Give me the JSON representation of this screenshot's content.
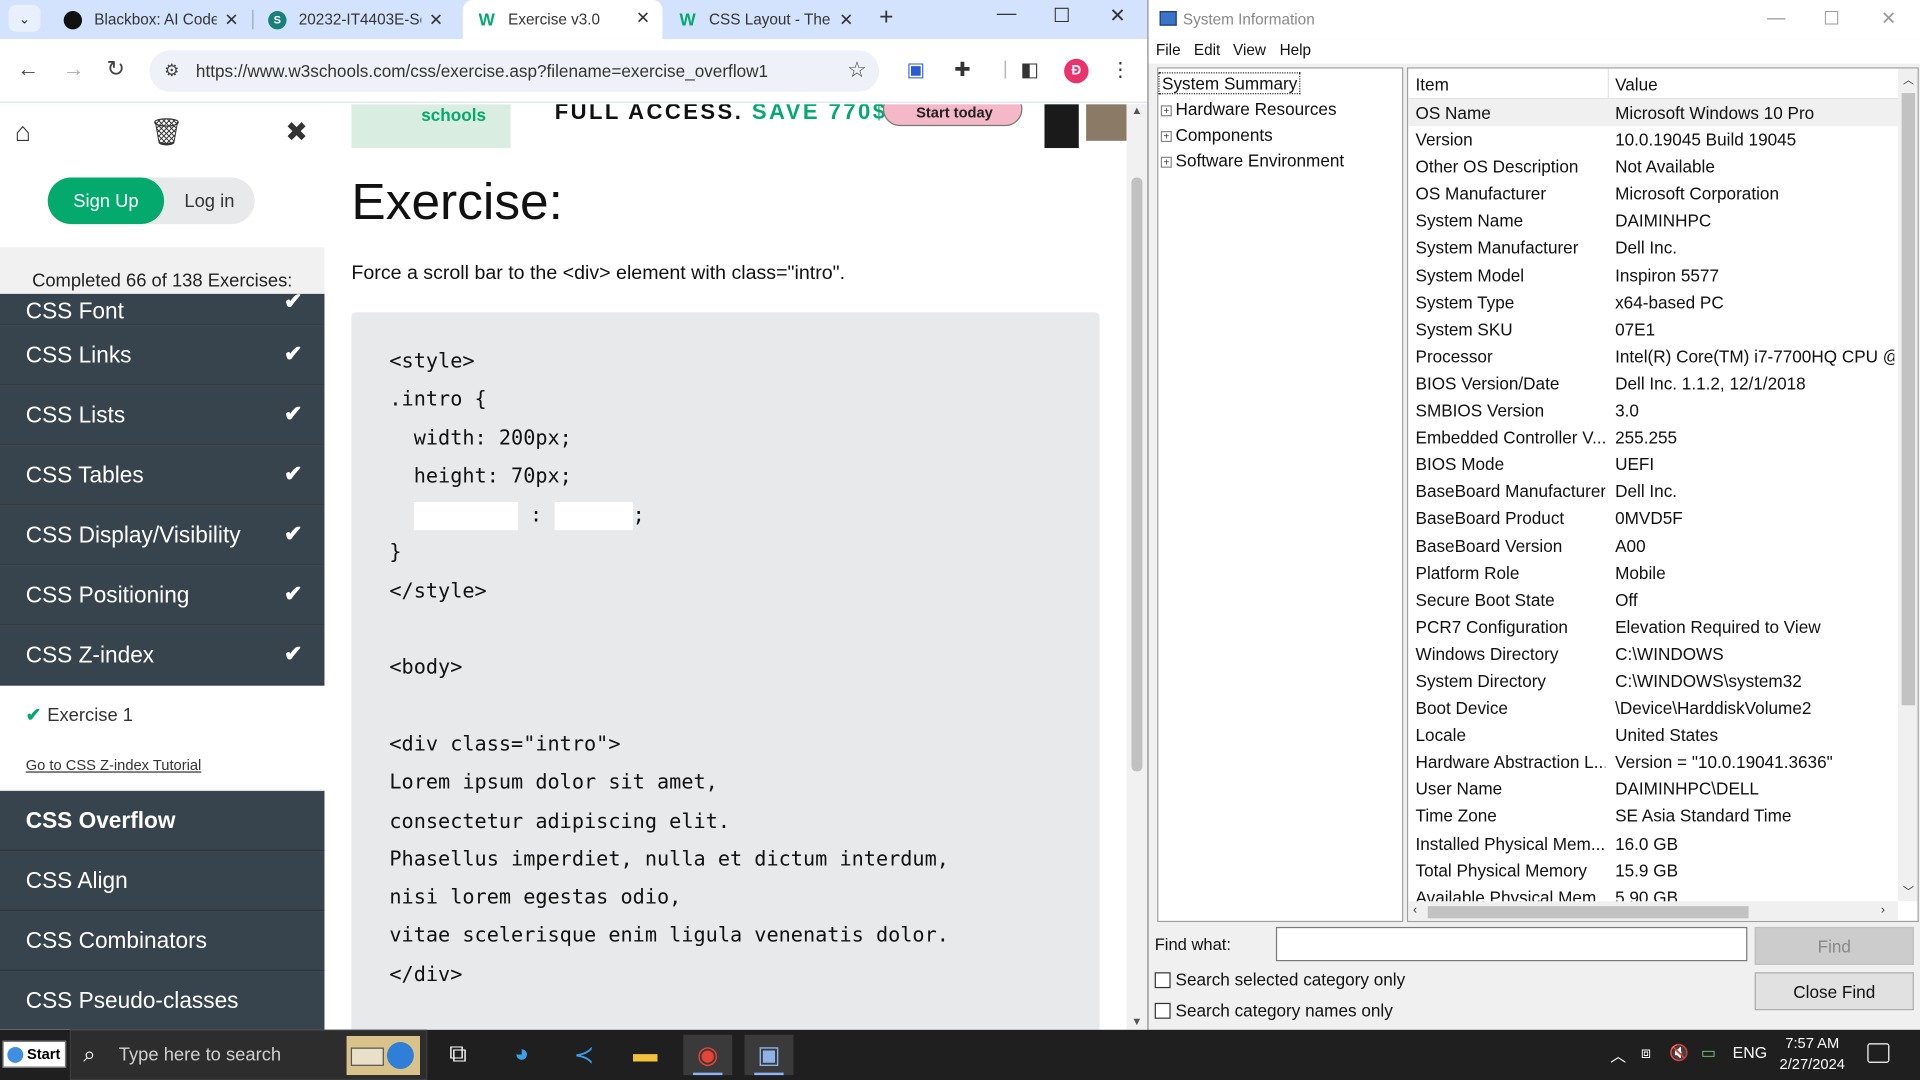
{
  "browser": {
    "tabs": [
      {
        "title": "Blackbox: AI Code",
        "fav_color": "#111111",
        "fav_glyph": "●"
      },
      {
        "title": "20232-IT4403E-Se",
        "fav_color": "#1b7f79",
        "fav_glyph": "S"
      },
      {
        "title": "Exercise v3.0",
        "fav_color": "#04aa6d",
        "fav_glyph": "W",
        "active": true
      },
      {
        "title": "CSS Layout - The",
        "fav_color": "#04aa6d",
        "fav_glyph": "W"
      }
    ],
    "url": "https://www.w3schools.com/css/exercise.asp?filename=exercise_overflow1",
    "profile_initial": "Đ"
  },
  "sidebar": {
    "signup": "Sign Up",
    "login": "Log in",
    "completed": "Completed 66 of 138 Exercises:",
    "topics_before": [
      "CSS Font",
      "CSS Links",
      "CSS Lists",
      "CSS Tables",
      "CSS Display/Visibility",
      "CSS Positioning",
      "CSS Z-index"
    ],
    "exercise": "Exercise 1",
    "tutorial_link": "Go to CSS Z-index Tutorial",
    "topics_after": [
      "CSS Overflow",
      "CSS Align",
      "CSS Combinators",
      "CSS Pseudo-classes"
    ]
  },
  "banner": {
    "brand": "schools",
    "headline": "FULL ACCESS.",
    "save": "SAVE 770$",
    "cta": "Start today"
  },
  "exercise": {
    "heading": "Exercise:",
    "task": "Force a scroll bar to the <div> element with class=\"intro\".",
    "code": [
      "<style>",
      ".intro {",
      "  width: 200px;",
      "  height: 70px;",
      "",
      "}",
      "</style>",
      "",
      "<body>",
      "",
      "<div class=\"intro\">",
      "Lorem ipsum dolor sit amet,",
      "consectetur adipiscing elit.",
      "Phasellus imperdiet, nulla et dictum interdum,",
      "nisi lorem egestas odio,",
      "vitae scelerisque enim ligula venenatis dolor.",
      "</div>"
    ],
    "blank_separator": ":",
    "blank_end": ";"
  },
  "sysinfo": {
    "title": "System Information",
    "menu": [
      "File",
      "Edit",
      "View",
      "Help"
    ],
    "tree": {
      "root": "System Summary",
      "children": [
        "Hardware Resources",
        "Components",
        "Software Environment"
      ]
    },
    "columns": [
      "Item",
      "Value"
    ],
    "rows": [
      {
        "k": "OS Name",
        "v": "Microsoft Windows 10 Pro"
      },
      {
        "k": "Version",
        "v": "10.0.19045 Build 19045"
      },
      {
        "k": "Other OS Description",
        "v": "Not Available"
      },
      {
        "k": "OS Manufacturer",
        "v": "Microsoft Corporation"
      },
      {
        "k": "System Name",
        "v": "DAIMINHPC"
      },
      {
        "k": "System Manufacturer",
        "v": "Dell Inc."
      },
      {
        "k": "System Model",
        "v": "Inspiron 5577"
      },
      {
        "k": "System Type",
        "v": "x64-based PC"
      },
      {
        "k": "System SKU",
        "v": "07E1"
      },
      {
        "k": "Processor",
        "v": "Intel(R) Core(TM) i7-7700HQ CPU @"
      },
      {
        "k": "BIOS Version/Date",
        "v": "Dell Inc. 1.1.2, 12/1/2018"
      },
      {
        "k": "SMBIOS Version",
        "v": "3.0"
      },
      {
        "k": "Embedded Controller V...",
        "v": "255.255"
      },
      {
        "k": "BIOS Mode",
        "v": "UEFI"
      },
      {
        "k": "BaseBoard Manufacturer",
        "v": "Dell Inc."
      },
      {
        "k": "BaseBoard Product",
        "v": "0MVD5F"
      },
      {
        "k": "BaseBoard Version",
        "v": "A00"
      },
      {
        "k": "Platform Role",
        "v": "Mobile"
      },
      {
        "k": "Secure Boot State",
        "v": "Off"
      },
      {
        "k": "PCR7 Configuration",
        "v": "Elevation Required to View"
      },
      {
        "k": "Windows Directory",
        "v": "C:\\WINDOWS"
      },
      {
        "k": "System Directory",
        "v": "C:\\WINDOWS\\system32"
      },
      {
        "k": "Boot Device",
        "v": "\\Device\\HarddiskVolume2"
      },
      {
        "k": "Locale",
        "v": "United States"
      },
      {
        "k": "Hardware Abstraction L...",
        "v": "Version = \"10.0.19041.3636\""
      },
      {
        "k": "User Name",
        "v": "DAIMINHPC\\DELL"
      },
      {
        "k": "Time Zone",
        "v": "SE Asia Standard Time"
      },
      {
        "k": "Installed Physical Mem...",
        "v": "16.0 GB"
      },
      {
        "k": "Total Physical Memory",
        "v": "15.9 GB"
      },
      {
        "k": "Available Physical Mem...",
        "v": "5.90 GB"
      }
    ],
    "find_label": "Find what:",
    "find_value": "",
    "find_button": "Find",
    "close_find_button": "Close Find",
    "opt_selected": "Search selected category only",
    "opt_names": "Search category names only"
  },
  "taskbar": {
    "start": "Start",
    "search_placeholder": "Type here to search",
    "language": "ENG",
    "time": "7:57 AM",
    "date": "2/27/2024"
  },
  "colors": {
    "w3_green": "#04aa6d",
    "sidebar_dark": "#38444d",
    "chrome_tabstrip": "#d3e3fd"
  }
}
